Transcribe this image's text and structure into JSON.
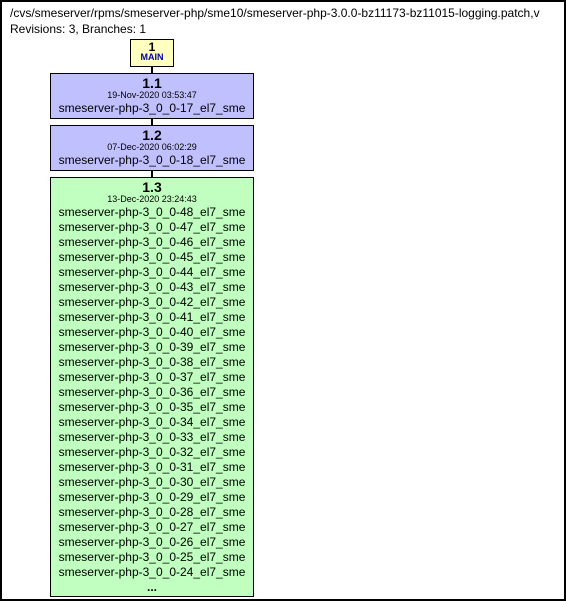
{
  "header": {
    "path": "/cvs/smeserver/rpms/smeserver-php/sme10/smeserver-php-3.0.0-bz11173-bz11015-logging.patch,v",
    "revisions_label": "Revisions: 3, Branches: 1"
  },
  "main": {
    "number": "1",
    "label": "MAIN"
  },
  "nodes": [
    {
      "version": "1.1",
      "date": "19-Nov-2020 03:53:47",
      "tags": [
        "smeserver-php-3_0_0-17_el7_sme"
      ],
      "color": "blue",
      "ellipsis": false
    },
    {
      "version": "1.2",
      "date": "07-Dec-2020 06:02:29",
      "tags": [
        "smeserver-php-3_0_0-18_el7_sme"
      ],
      "color": "blue",
      "ellipsis": false
    },
    {
      "version": "1.3",
      "date": "13-Dec-2020 23:24:43",
      "tags": [
        "smeserver-php-3_0_0-48_el7_sme",
        "smeserver-php-3_0_0-47_el7_sme",
        "smeserver-php-3_0_0-46_el7_sme",
        "smeserver-php-3_0_0-45_el7_sme",
        "smeserver-php-3_0_0-44_el7_sme",
        "smeserver-php-3_0_0-43_el7_sme",
        "smeserver-php-3_0_0-42_el7_sme",
        "smeserver-php-3_0_0-41_el7_sme",
        "smeserver-php-3_0_0-40_el7_sme",
        "smeserver-php-3_0_0-39_el7_sme",
        "smeserver-php-3_0_0-38_el7_sme",
        "smeserver-php-3_0_0-37_el7_sme",
        "smeserver-php-3_0_0-36_el7_sme",
        "smeserver-php-3_0_0-35_el7_sme",
        "smeserver-php-3_0_0-34_el7_sme",
        "smeserver-php-3_0_0-33_el7_sme",
        "smeserver-php-3_0_0-32_el7_sme",
        "smeserver-php-3_0_0-31_el7_sme",
        "smeserver-php-3_0_0-30_el7_sme",
        "smeserver-php-3_0_0-29_el7_sme",
        "smeserver-php-3_0_0-28_el7_sme",
        "smeserver-php-3_0_0-27_el7_sme",
        "smeserver-php-3_0_0-26_el7_sme",
        "smeserver-php-3_0_0-25_el7_sme",
        "smeserver-php-3_0_0-24_el7_sme"
      ],
      "color": "green",
      "ellipsis": true
    }
  ]
}
